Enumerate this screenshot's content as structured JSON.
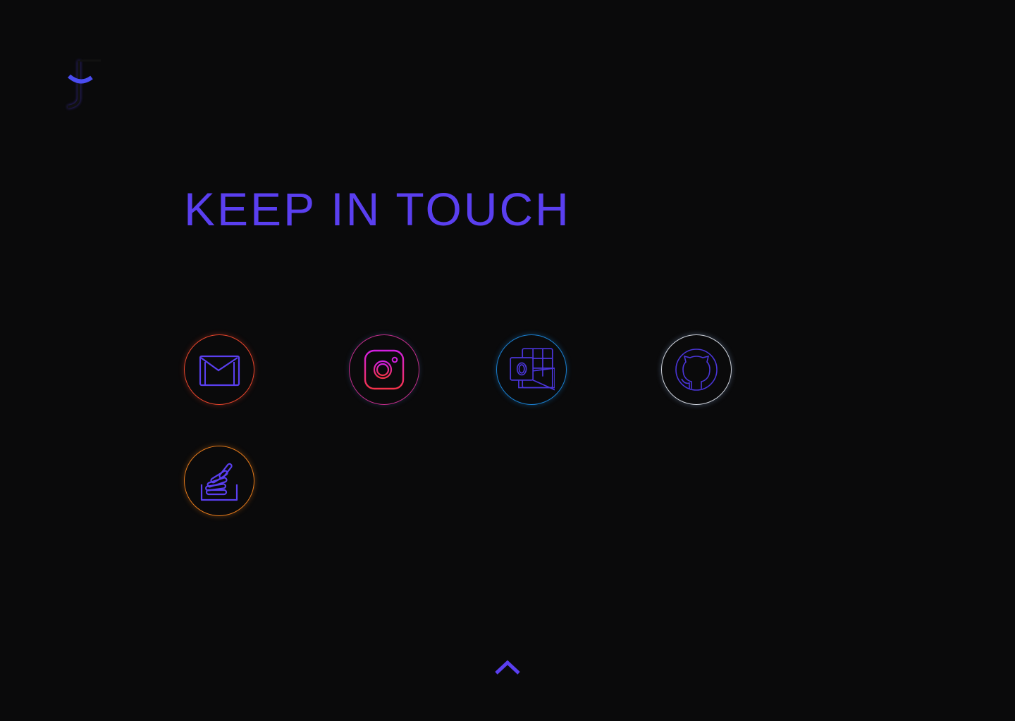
{
  "logo": {
    "alt": "J"
  },
  "title": "KEEP IN TOUCH",
  "social_links": [
    {
      "name": "gmail",
      "icon": "mail-icon",
      "ring_color": "#e8452c"
    },
    {
      "name": "instagram",
      "icon": "instagram-icon",
      "ring_color": "#c22d8a"
    },
    {
      "name": "outlook",
      "icon": "outlook-icon",
      "ring_color": "#1a7fd0"
    },
    {
      "name": "github",
      "icon": "github-icon",
      "ring_color": "#d0d4dc"
    },
    {
      "name": "stackoverflow",
      "icon": "stackoverflow-icon",
      "ring_color": "#e47a1b"
    }
  ],
  "colors": {
    "accent": "#5a3ff0",
    "background": "#0a0a0b"
  },
  "scroll_top": {
    "icon": "chevron-up-icon"
  }
}
